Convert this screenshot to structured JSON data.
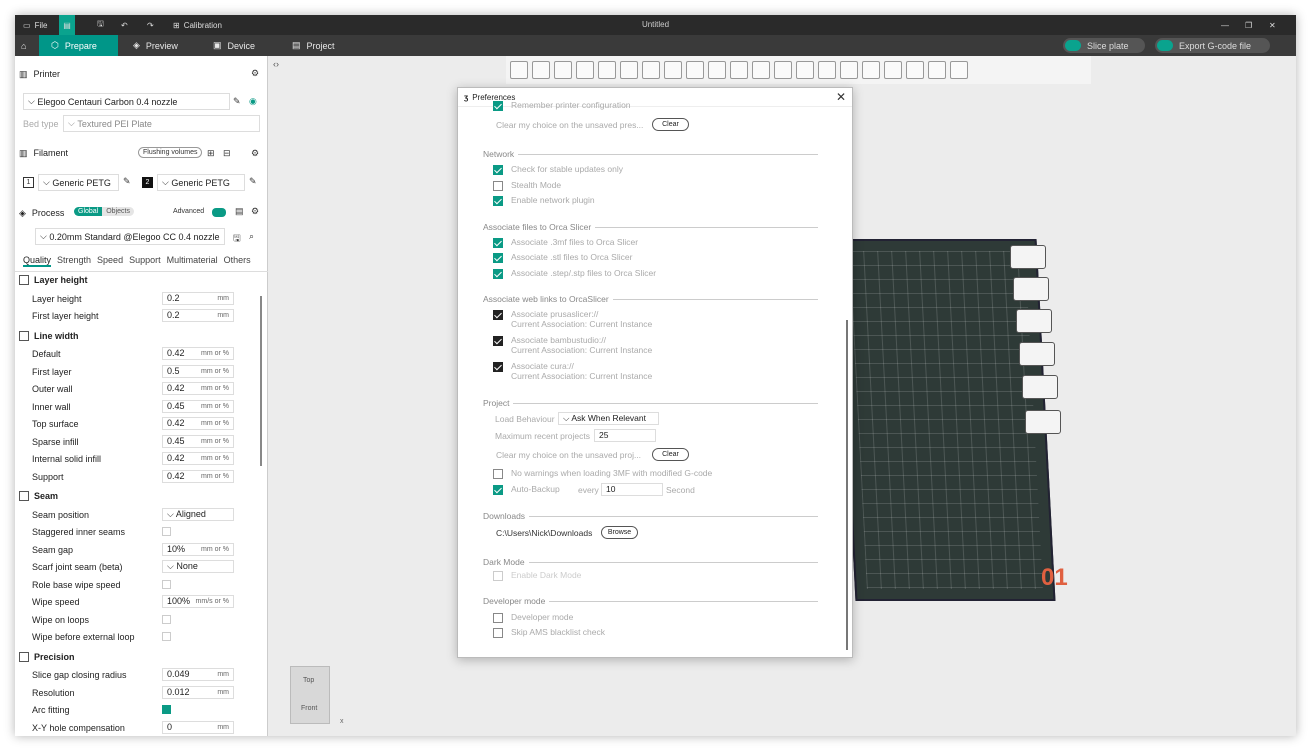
{
  "titlebar": {
    "file_label": "File",
    "calibration_label": "Calibration",
    "title": "Untitled"
  },
  "nav": {
    "tabs": [
      {
        "label": "Prepare"
      },
      {
        "label": "Preview"
      },
      {
        "label": "Device"
      },
      {
        "label": "Project"
      }
    ],
    "slice_label": "Slice plate",
    "export_label": "Export G-code file"
  },
  "printer": {
    "heading": "Printer",
    "name": "Elegoo Centauri Carbon 0.4 nozzle",
    "bed_label": "Bed type",
    "bed_value": "Textured PEI Plate"
  },
  "filament": {
    "heading": "Filament",
    "flush_label": "Flushing volumes",
    "slot1_num": "1",
    "slot1": "Generic PETG",
    "slot2_num": "2",
    "slot2": "Generic PETG"
  },
  "process": {
    "heading": "Process",
    "global": "Global",
    "objects": "Objects",
    "advanced": "Advanced",
    "profile": "0.20mm Standard @Elegoo CC 0.4 nozzle"
  },
  "tabs": [
    "Quality",
    "Strength",
    "Speed",
    "Support",
    "Multimaterial",
    "Others"
  ],
  "groups": {
    "layer_height": {
      "title": "Layer height",
      "rows": [
        {
          "label": "Layer height",
          "value": "0.2",
          "unit": "mm"
        },
        {
          "label": "First layer height",
          "value": "0.2",
          "unit": "mm"
        }
      ]
    },
    "line_width": {
      "title": "Line width",
      "rows": [
        {
          "label": "Default",
          "value": "0.42",
          "unit": "mm or %"
        },
        {
          "label": "First layer",
          "value": "0.5",
          "unit": "mm or %"
        },
        {
          "label": "Outer wall",
          "value": "0.42",
          "unit": "mm or %"
        },
        {
          "label": "Inner wall",
          "value": "0.45",
          "unit": "mm or %"
        },
        {
          "label": "Top surface",
          "value": "0.42",
          "unit": "mm or %"
        },
        {
          "label": "Sparse infill",
          "value": "0.45",
          "unit": "mm or %"
        },
        {
          "label": "Internal solid infill",
          "value": "0.42",
          "unit": "mm or %"
        },
        {
          "label": "Support",
          "value": "0.42",
          "unit": "mm or %"
        }
      ]
    },
    "seam": {
      "title": "Seam",
      "seam_position_label": "Seam position",
      "seam_position": "Aligned",
      "staggered_label": "Staggered inner seams",
      "gap_label": "Seam gap",
      "gap_value": "10%",
      "gap_unit": "mm or %",
      "scarf_label": "Scarf joint seam (beta)",
      "scarf_value": "None",
      "role_label": "Role base wipe speed",
      "wipe_speed_label": "Wipe speed",
      "wipe_speed_value": "100%",
      "wipe_speed_unit": "mm/s or %",
      "wipe_loops_label": "Wipe on loops",
      "wipe_ext_label": "Wipe before external loop"
    },
    "precision": {
      "title": "Precision",
      "slice_gap_label": "Slice gap closing radius",
      "slice_gap_value": "0.049",
      "slice_gap_unit": "mm",
      "resolution_label": "Resolution",
      "resolution_value": "0.012",
      "resolution_unit": "mm",
      "arc_label": "Arc fitting",
      "xy_label": "X-Y hole compensation",
      "xy_value": "0",
      "xy_unit": "mm"
    }
  },
  "cube": {
    "top": "Top",
    "front": "Front",
    "axis": "x"
  },
  "plate_number": "01",
  "dialog": {
    "title": "Preferences",
    "remember_label": "Remember printer configuration",
    "clear_choice_1": "Clear my choice on the unsaved pres...",
    "clear_btn": "Clear",
    "network": {
      "title": "Network",
      "stable": "Check for stable updates only",
      "stealth": "Stealth Mode",
      "plugin": "Enable network plugin"
    },
    "assoc_files": {
      "title": "Associate files to Orca Slicer",
      "f3mf": "Associate .3mf files to Orca Slicer",
      "fstl": "Associate .stl files to Orca Slicer",
      "fstep": "Associate .step/.stp files to Orca Slicer"
    },
    "assoc_web": {
      "title": "Associate web links to OrcaSlicer",
      "prusa": "Associate prusaslicer://",
      "bambu": "Associate bambustudio://",
      "cura": "Associate cura://",
      "current": "Current Association: Current Instance"
    },
    "project": {
      "title": "Project",
      "load_label": "Load Behaviour",
      "load_value": "Ask When Relevant",
      "max_label": "Maximum recent projects",
      "max_value": "25",
      "clear_choice_2": "Clear my choice on the unsaved proj...",
      "no_warn": "No warnings when loading 3MF with modified G-code",
      "auto_backup": "Auto-Backup",
      "every": "every",
      "every_value": "10",
      "second": "Second"
    },
    "downloads": {
      "title": "Downloads",
      "path": "C:\\Users\\Nick\\Downloads",
      "browse": "Browse"
    },
    "dark": {
      "title": "Dark Mode",
      "enable": "Enable Dark Mode"
    },
    "developer": {
      "title": "Developer mode",
      "dev": "Developer mode",
      "skip": "Skip AMS blacklist check"
    }
  }
}
